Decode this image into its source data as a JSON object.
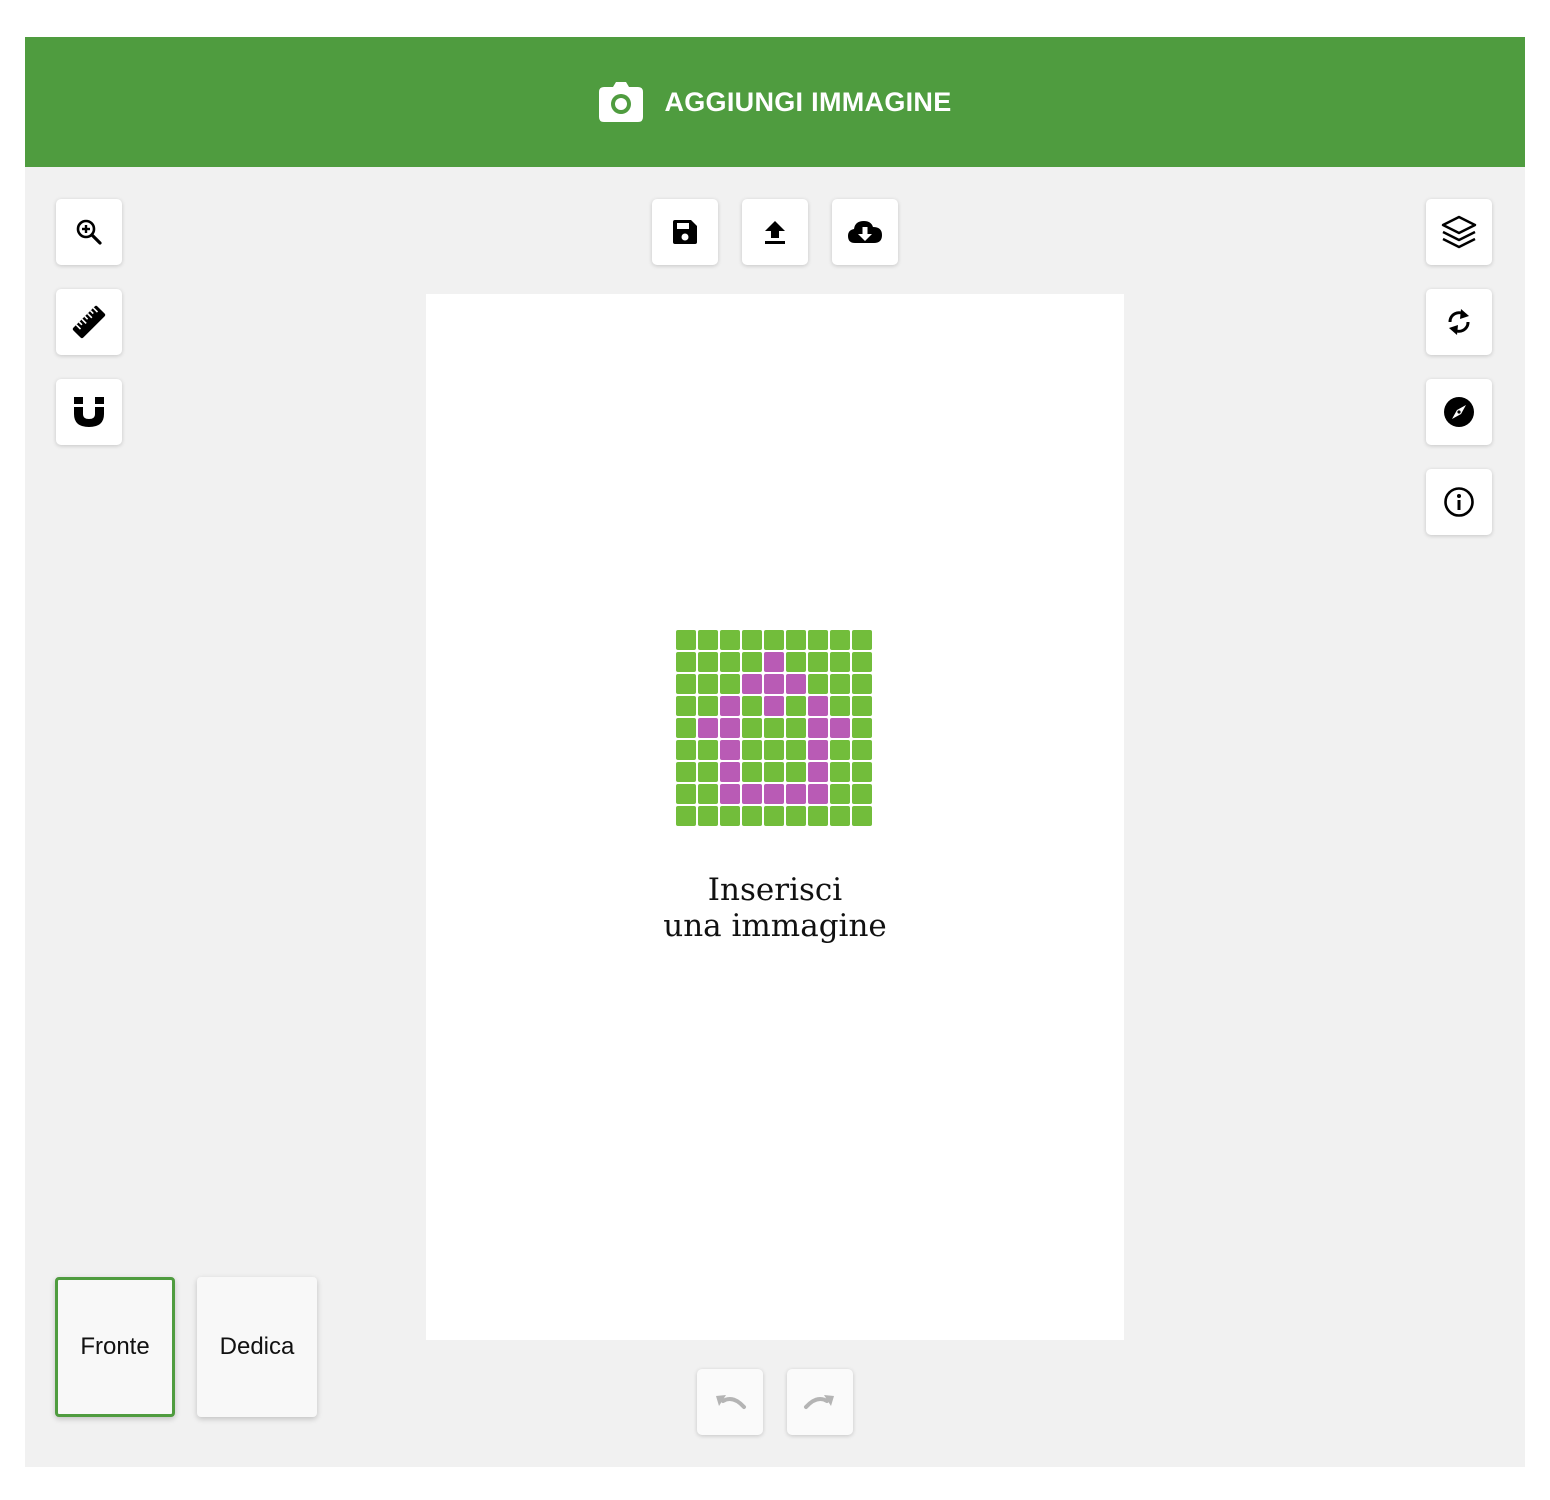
{
  "header": {
    "title": "AGGIUNGI IMMAGINE",
    "icon": "camera-icon",
    "background": "#4f9c3f"
  },
  "left_toolbar": [
    {
      "id": "zoom",
      "icon": "zoom-in-icon"
    },
    {
      "id": "ruler",
      "icon": "ruler-icon"
    },
    {
      "id": "magnet",
      "icon": "magnet-icon"
    }
  ],
  "top_toolbar": [
    {
      "id": "save",
      "icon": "floppy-disk-icon"
    },
    {
      "id": "upload",
      "icon": "upload-icon"
    },
    {
      "id": "cloud-download",
      "icon": "cloud-download-icon"
    }
  ],
  "right_toolbar": [
    {
      "id": "layers",
      "icon": "layers-icon"
    },
    {
      "id": "rotate",
      "icon": "rotate-icon"
    },
    {
      "id": "compass",
      "icon": "compass-icon"
    },
    {
      "id": "info",
      "icon": "info-icon"
    }
  ],
  "canvas": {
    "placeholder_line1": "Inserisci",
    "placeholder_line2": "una immagine",
    "pixel_grid": {
      "colors": {
        "cell": "#72bd3b",
        "highlight": "#b95bb5"
      },
      "rows": [
        "000000000",
        "000010000",
        "000111000",
        "001010100",
        "011000110",
        "001000100",
        "001000100",
        "001111100",
        "000000000"
      ]
    }
  },
  "page_tabs": [
    {
      "label": "Fronte",
      "active": true
    },
    {
      "label": "Dedica",
      "active": false
    }
  ],
  "history": [
    {
      "id": "undo",
      "icon": "undo-icon",
      "enabled": false
    },
    {
      "id": "redo",
      "icon": "redo-icon",
      "enabled": false
    }
  ]
}
